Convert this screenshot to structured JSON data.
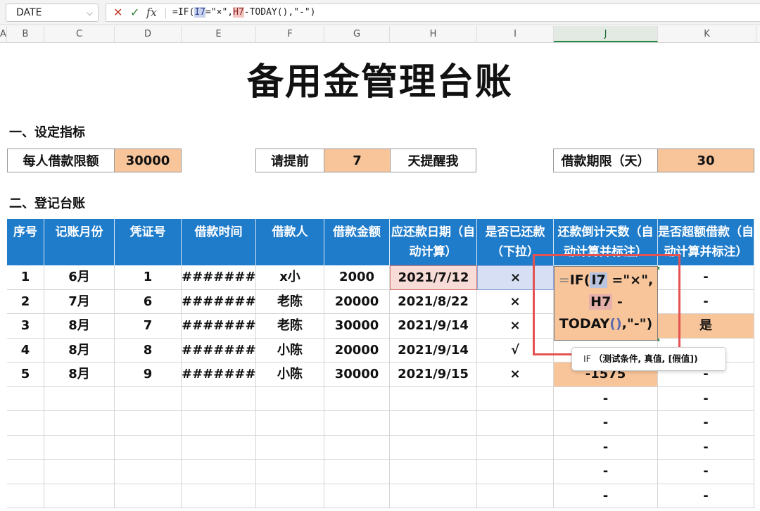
{
  "name_box": "DATE",
  "formula_bar": {
    "prefix": "=IF(",
    "ref1": "I7",
    "mid": "=\"×\",",
    "ref2": "H7",
    "suffix": "-TODAY(),\"-\")"
  },
  "columns": [
    "A",
    "B",
    "C",
    "D",
    "E",
    "F",
    "G",
    "H",
    "I",
    "J",
    "K"
  ],
  "active_column": "J",
  "title": "备用金管理台账",
  "section1": "一、设定指标",
  "section2": "二、登记台账",
  "settings": {
    "limit_label": "每人借款限额",
    "limit_value": "30000",
    "remind_label": "请提前",
    "remind_value": "7",
    "remind_suffix": "天提醒我",
    "term_label": "借款期限（天）",
    "term_value": "30"
  },
  "table": {
    "headers": [
      "序号",
      "记账月份",
      "凭证号",
      "借款时间",
      "借款人",
      "借款金额",
      "应还款日期（自动计算）",
      "是否已还款（下拉）",
      "还款倒计天数（自动计算并标注）",
      "是否超额借款（自动计算并标注）"
    ],
    "rows": [
      [
        "1",
        "6月",
        "1",
        "########",
        "x小",
        "2000",
        "2021/7/12",
        "×",
        "",
        "-"
      ],
      [
        "2",
        "7月",
        "6",
        "########",
        "老陈",
        "20000",
        "2021/8/22",
        "×",
        "",
        "-"
      ],
      [
        "3",
        "8月",
        "7",
        "########",
        "老陈",
        "30000",
        "2021/9/14",
        "×",
        "",
        "是"
      ],
      [
        "4",
        "8月",
        "8",
        "########",
        "小陈",
        "20000",
        "2021/9/14",
        "√",
        "",
        ""
      ],
      [
        "5",
        "8月",
        "9",
        "########",
        "小陈",
        "30000",
        "2021/9/15",
        "×",
        "-1575",
        "-"
      ],
      [
        "",
        "",
        "",
        "",
        "",
        "",
        "",
        "",
        "-",
        "-"
      ],
      [
        "",
        "",
        "",
        "",
        "",
        "",
        "",
        "",
        "-",
        "-"
      ],
      [
        "",
        "",
        "",
        "",
        "",
        "",
        "",
        "",
        "-",
        "-"
      ],
      [
        "",
        "",
        "",
        "",
        "",
        "",
        "",
        "",
        "-",
        "-"
      ],
      [
        "",
        "",
        "",
        "",
        "",
        "",
        "",
        "",
        "-",
        "-"
      ]
    ]
  },
  "editing_cell": {
    "eq": "=",
    "l1a": "IF(",
    "ref1": "I7",
    "l1b": "=\"×\",",
    "ref2": "H7",
    "l2b": "-",
    "l3a": "TODAY",
    "l3p": "()",
    "l3b": ",\"-\")"
  },
  "tooltip": {
    "func": "IF",
    "args": "（测试条件, 真值, [假值])"
  },
  "colors": {
    "header_blue": "#1f7ccb",
    "peach": "#f8c59b",
    "highlight_red": "#e45252"
  }
}
